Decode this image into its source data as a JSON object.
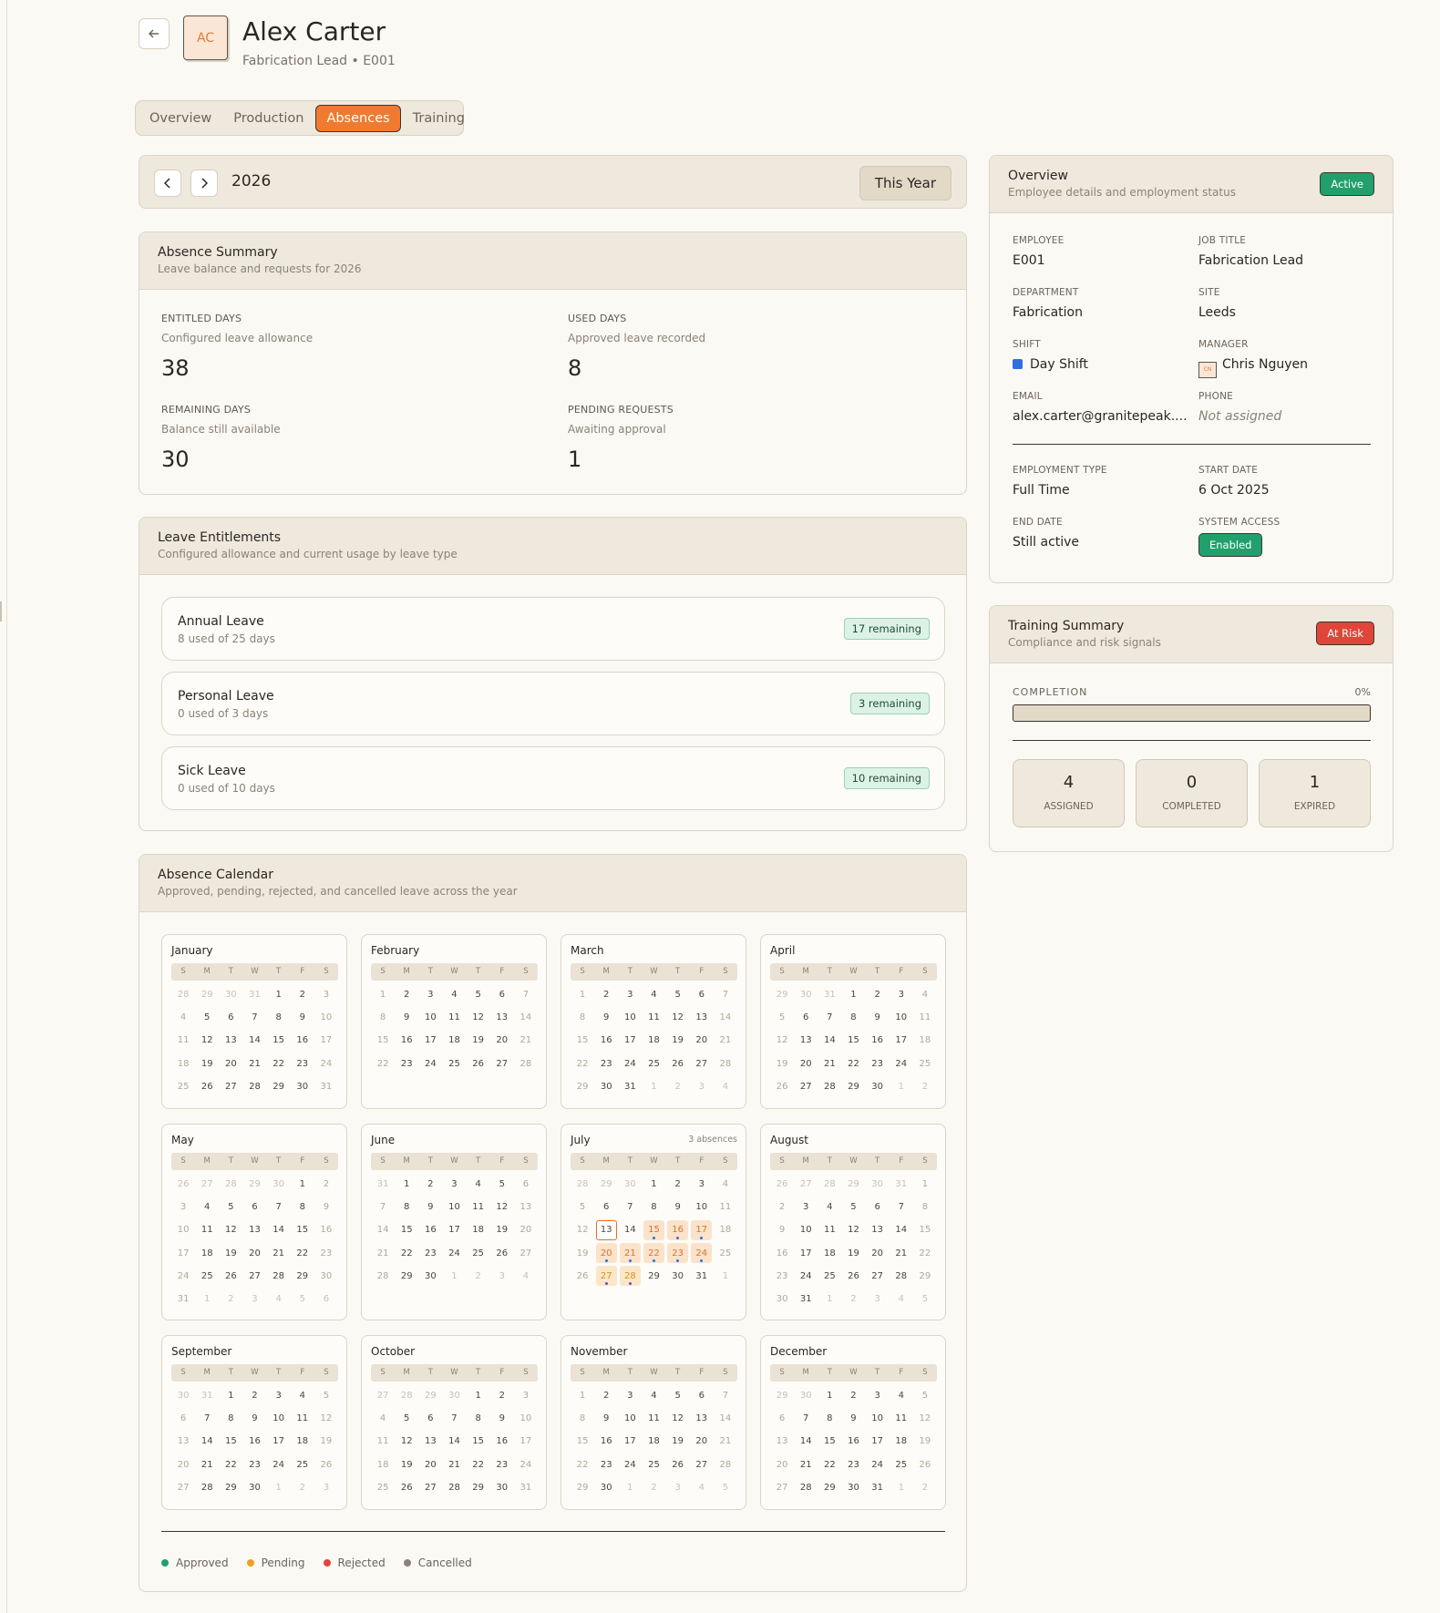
{
  "header": {
    "back_icon": "arrow-left-icon",
    "avatar_initials": "AC",
    "name": "Alex Carter",
    "subtitle": "Fabrication Lead • E001"
  },
  "tabs": [
    "Overview",
    "Production",
    "Absences",
    "Training"
  ],
  "active_tab": "Absences",
  "year_nav": {
    "prev_icon": "chevron-left-icon",
    "next_icon": "chevron-right-icon",
    "year": "2026",
    "this_year_label": "This Year"
  },
  "absence_summary": {
    "title": "Absence Summary",
    "subtitle": "Leave balance and requests for 2026",
    "stats": [
      {
        "key": "ENTITLED DAYS",
        "desc": "Configured leave allowance",
        "value": "38"
      },
      {
        "key": "USED DAYS",
        "desc": "Approved leave recorded",
        "value": "8"
      },
      {
        "key": "REMAINING DAYS",
        "desc": "Balance still available",
        "value": "30"
      },
      {
        "key": "PENDING REQUESTS",
        "desc": "Awaiting approval",
        "value": "1"
      }
    ]
  },
  "leave_entitlements": {
    "title": "Leave Entitlements",
    "subtitle": "Configured allowance and current usage by leave type",
    "items": [
      {
        "name": "Annual Leave",
        "usage": "8 used of 25 days",
        "remaining": "17 remaining"
      },
      {
        "name": "Personal Leave",
        "usage": "0 used of 3 days",
        "remaining": "3 remaining"
      },
      {
        "name": "Sick Leave",
        "usage": "0 used of 10 days",
        "remaining": "10 remaining"
      }
    ]
  },
  "absence_calendar": {
    "title": "Absence Calendar",
    "subtitle": "Approved, pending, rejected, and cancelled leave across the year",
    "weekdays": [
      "S",
      "M",
      "T",
      "W",
      "T",
      "F",
      "S"
    ],
    "months": [
      {
        "name": "January",
        "days": [
          "28",
          "29",
          "30",
          "31",
          "1",
          "2",
          "3",
          "4",
          "5",
          "6",
          "7",
          "8",
          "9",
          "10",
          "11",
          "12",
          "13",
          "14",
          "15",
          "16",
          "17",
          "18",
          "19",
          "20",
          "21",
          "22",
          "23",
          "24",
          "25",
          "26",
          "27",
          "28",
          "29",
          "30",
          "31"
        ]
      },
      {
        "name": "February",
        "days": [
          "1",
          "2",
          "3",
          "4",
          "5",
          "6",
          "7",
          "8",
          "9",
          "10",
          "11",
          "12",
          "13",
          "14",
          "15",
          "16",
          "17",
          "18",
          "19",
          "20",
          "21",
          "22",
          "23",
          "24",
          "25",
          "26",
          "27",
          "28"
        ]
      },
      {
        "name": "March",
        "days": [
          "1",
          "2",
          "3",
          "4",
          "5",
          "6",
          "7",
          "8",
          "9",
          "10",
          "11",
          "12",
          "13",
          "14",
          "15",
          "16",
          "17",
          "18",
          "19",
          "20",
          "21",
          "22",
          "23",
          "24",
          "25",
          "26",
          "27",
          "28",
          "29",
          "30",
          "31",
          "1",
          "2",
          "3",
          "4"
        ]
      },
      {
        "name": "April",
        "days": [
          "29",
          "30",
          "31",
          "1",
          "2",
          "3",
          "4",
          "5",
          "6",
          "7",
          "8",
          "9",
          "10",
          "11",
          "12",
          "13",
          "14",
          "15",
          "16",
          "17",
          "18",
          "19",
          "20",
          "21",
          "22",
          "23",
          "24",
          "25",
          "26",
          "27",
          "28",
          "29",
          "30",
          "1",
          "2"
        ]
      },
      {
        "name": "May",
        "days": [
          "26",
          "27",
          "28",
          "29",
          "30",
          "1",
          "2",
          "3",
          "4",
          "5",
          "6",
          "7",
          "8",
          "9",
          "10",
          "11",
          "12",
          "13",
          "14",
          "15",
          "16",
          "17",
          "18",
          "19",
          "20",
          "21",
          "22",
          "23",
          "24",
          "25",
          "26",
          "27",
          "28",
          "29",
          "30",
          "31",
          "1",
          "2",
          "3",
          "4",
          "5",
          "6"
        ]
      },
      {
        "name": "June",
        "days": [
          "31",
          "1",
          "2",
          "3",
          "4",
          "5",
          "6",
          "7",
          "8",
          "9",
          "10",
          "11",
          "12",
          "13",
          "14",
          "15",
          "16",
          "17",
          "18",
          "19",
          "20",
          "21",
          "22",
          "23",
          "24",
          "25",
          "26",
          "27",
          "28",
          "29",
          "30",
          "1",
          "2",
          "3",
          "4"
        ]
      },
      {
        "name": "July",
        "count": "3 absences",
        "days": [
          "28",
          "29",
          "30",
          "1",
          "2",
          "3",
          "4",
          "5",
          "6",
          "7",
          "8",
          "9",
          "10",
          "11",
          "12",
          "13",
          "14",
          "15",
          "16",
          "17",
          "18",
          "19",
          "20",
          "21",
          "22",
          "23",
          "24",
          "25",
          "26",
          "27",
          "28",
          "29",
          "30",
          "31",
          "1"
        ]
      },
      {
        "name": "August",
        "days": [
          "26",
          "27",
          "28",
          "29",
          "30",
          "31",
          "1",
          "2",
          "3",
          "4",
          "5",
          "6",
          "7",
          "8",
          "9",
          "10",
          "11",
          "12",
          "13",
          "14",
          "15",
          "16",
          "17",
          "18",
          "19",
          "20",
          "21",
          "22",
          "23",
          "24",
          "25",
          "26",
          "27",
          "28",
          "29",
          "30",
          "31",
          "1",
          "2",
          "3",
          "4",
          "5"
        ]
      },
      {
        "name": "September",
        "days": [
          "30",
          "31",
          "1",
          "2",
          "3",
          "4",
          "5",
          "6",
          "7",
          "8",
          "9",
          "10",
          "11",
          "12",
          "13",
          "14",
          "15",
          "16",
          "17",
          "18",
          "19",
          "20",
          "21",
          "22",
          "23",
          "24",
          "25",
          "26",
          "27",
          "28",
          "29",
          "30",
          "1",
          "2",
          "3"
        ]
      },
      {
        "name": "October",
        "days": [
          "27",
          "28",
          "29",
          "30",
          "1",
          "2",
          "3",
          "4",
          "5",
          "6",
          "7",
          "8",
          "9",
          "10",
          "11",
          "12",
          "13",
          "14",
          "15",
          "16",
          "17",
          "18",
          "19",
          "20",
          "21",
          "22",
          "23",
          "24",
          "25",
          "26",
          "27",
          "28",
          "29",
          "30",
          "31"
        ]
      },
      {
        "name": "November",
        "days": [
          "1",
          "2",
          "3",
          "4",
          "5",
          "6",
          "7",
          "8",
          "9",
          "10",
          "11",
          "12",
          "13",
          "14",
          "15",
          "16",
          "17",
          "18",
          "19",
          "20",
          "21",
          "22",
          "23",
          "24",
          "25",
          "26",
          "27",
          "28",
          "29",
          "30",
          "1",
          "2",
          "3",
          "4",
          "5"
        ]
      },
      {
        "name": "December",
        "days": [
          "29",
          "30",
          "1",
          "2",
          "3",
          "4",
          "5",
          "6",
          "7",
          "8",
          "9",
          "10",
          "11",
          "12",
          "13",
          "14",
          "15",
          "16",
          "17",
          "18",
          "19",
          "20",
          "21",
          "22",
          "23",
          "24",
          "25",
          "26",
          "27",
          "28",
          "29",
          "30",
          "31",
          "1",
          "2"
        ]
      }
    ],
    "july_marks": {
      "today": "13",
      "approved": [
        "15",
        "16",
        "17",
        "20",
        "21",
        "22",
        "23",
        "24"
      ],
      "pending": [
        "27",
        "28"
      ]
    },
    "legend": [
      {
        "label": "Approved",
        "color": "#22a06b"
      },
      {
        "label": "Pending",
        "color": "#f0a020"
      },
      {
        "label": "Rejected",
        "color": "#e0453a"
      },
      {
        "label": "Cancelled",
        "color": "#8a8276"
      }
    ]
  },
  "overview": {
    "title": "Overview",
    "subtitle": "Employee details and employment status",
    "status": "Active",
    "fields": [
      {
        "key": "EMPLOYEE",
        "value": "E001"
      },
      {
        "key": "JOB TITLE",
        "value": "Fabrication Lead"
      },
      {
        "key": "DEPARTMENT",
        "value": "Fabrication"
      },
      {
        "key": "SITE",
        "value": "Leeds"
      },
      {
        "key": "SHIFT",
        "value": "Day Shift",
        "color": "#2f6fe0"
      },
      {
        "key": "MANAGER",
        "value": "Chris Nguyen",
        "initials": "CN"
      },
      {
        "key": "EMAIL",
        "value": "alex.carter@granitepeak...."
      },
      {
        "key": "PHONE",
        "value": "Not assigned"
      },
      {
        "key": "EMPLOYMENT TYPE",
        "value": "Full Time"
      },
      {
        "key": "START DATE",
        "value": "6 Oct 2025"
      },
      {
        "key": "END DATE",
        "value": "Still active"
      },
      {
        "key": "SYSTEM ACCESS",
        "value": "Enabled"
      }
    ]
  },
  "training_summary": {
    "title": "Training Summary",
    "subtitle": "Compliance and risk signals",
    "status": "At Risk",
    "completion_label": "COMPLETION",
    "completion_value": "0%",
    "completion_fraction": 0,
    "boxes": [
      {
        "value": "4",
        "label": "ASSIGNED"
      },
      {
        "value": "0",
        "label": "COMPLETED"
      },
      {
        "value": "1",
        "label": "EXPIRED"
      }
    ]
  },
  "colors": {
    "accent": "#f07a2e",
    "success": "#22a06b",
    "danger": "#e0453a",
    "dot_blue": "#2f6fe0",
    "dot_purple": "#7a3fd0"
  }
}
